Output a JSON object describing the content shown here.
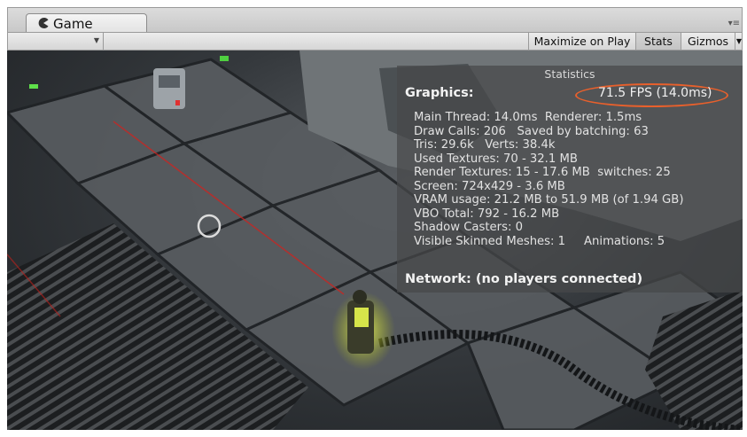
{
  "tab": {
    "title": "Game",
    "icon": "pacman-icon"
  },
  "toolbar": {
    "maximize_label": "Maximize on Play",
    "stats_label": "Stats",
    "gizmos_label": "Gizmos"
  },
  "stats": {
    "title": "Statistics",
    "graphics_label": "Graphics:",
    "fps": "71.5 FPS (14.0ms)",
    "lines": [
      "Main Thread: 14.0ms  Renderer: 1.5ms",
      "Draw Calls: 206   Saved by batching: 63",
      "Tris: 29.6k   Verts: 38.4k",
      "Used Textures: 70 - 32.1 MB",
      "Render Textures: 15 - 17.6 MB  switches: 25",
      "Screen: 724x429 - 3.6 MB",
      "VRAM usage: 21.2 MB to 51.9 MB (of 1.94 GB)",
      "VBO Total: 792 - 16.2 MB",
      "Shadow Casters: 0",
      "Visible Skinned Meshes: 1     Animations: 5"
    ],
    "network_label": "Network: (no players connected)"
  },
  "colors": {
    "highlight_ring": "#e8602c",
    "overlay": "#46484a"
  }
}
